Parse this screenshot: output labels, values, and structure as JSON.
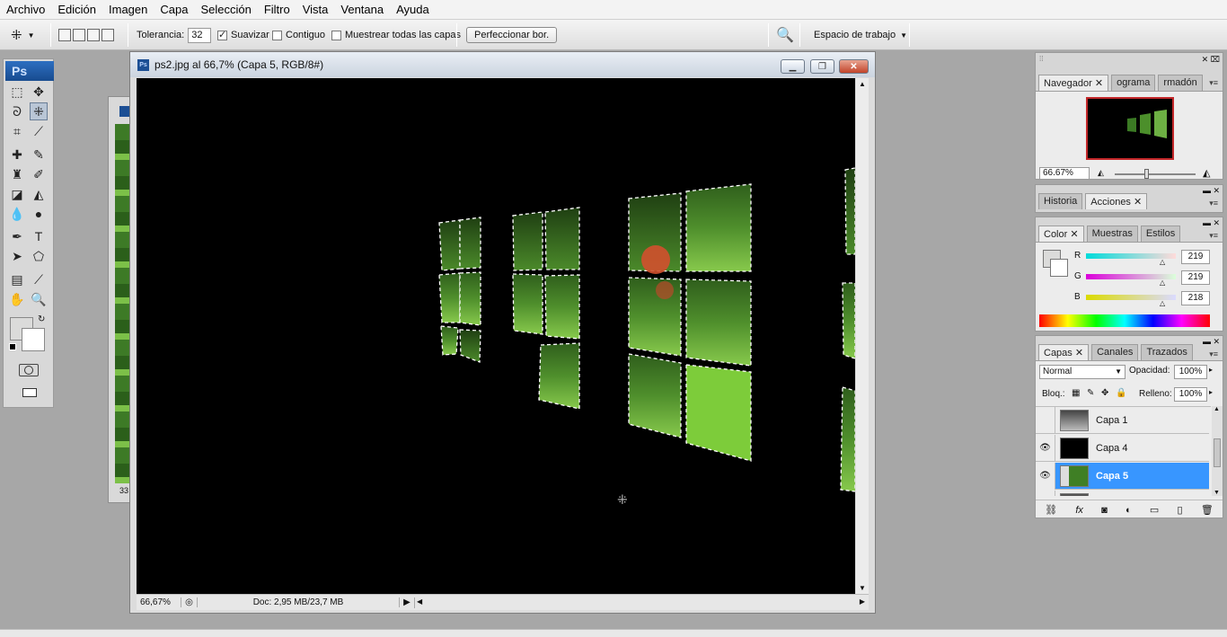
{
  "menu": [
    "Archivo",
    "Edición",
    "Imagen",
    "Capa",
    "Selección",
    "Filtro",
    "Vista",
    "Ventana",
    "Ayuda"
  ],
  "options": {
    "tolerance_label": "Tolerancia:",
    "tolerance_value": "32",
    "smooth_label": "Suavizar",
    "smooth_checked": true,
    "contiguous_label": "Contiguo",
    "contiguous_checked": false,
    "sample_all_label": "Muestrear todas las capas",
    "sample_all_checked": false,
    "refine_edge_label": "Perfeccionar bor.",
    "workspace_label": "Espacio de trabajo"
  },
  "toolbox": {
    "logo": "Ps"
  },
  "document": {
    "title": "ps2.jpg al 66,7% (Capa 5, RGB/8#)",
    "zoom": "66,67%",
    "doc_info": "Doc: 2,95 MB/23,7 MB",
    "background_doc_label": "33"
  },
  "navigator": {
    "tabs": [
      "Navegador",
      "ograma",
      "rmadón"
    ],
    "zoom": "66.67%"
  },
  "history": {
    "tabs": [
      "Historia",
      "Acciones"
    ]
  },
  "color": {
    "tabs": [
      "Color",
      "Muestras",
      "Estilos"
    ],
    "r_label": "R",
    "r_value": "219",
    "g_label": "G",
    "g_value": "219",
    "b_label": "B",
    "b_value": "218"
  },
  "layers": {
    "tabs": [
      "Capas",
      "Canales",
      "Trazados"
    ],
    "blend_mode": "Normal",
    "opacity_label": "Opacidad:",
    "opacity_value": "100%",
    "lock_label": "Bloq.:",
    "fill_label": "Relleno:",
    "fill_value": "100%",
    "items": [
      {
        "name": "Capa 1",
        "visible": false,
        "selected": false
      },
      {
        "name": "Capa 4",
        "visible": true,
        "selected": false
      },
      {
        "name": "Capa 5",
        "visible": true,
        "selected": true
      }
    ]
  },
  "colors": {
    "selection_blue": "#3896ff",
    "canvas": "#000000"
  }
}
